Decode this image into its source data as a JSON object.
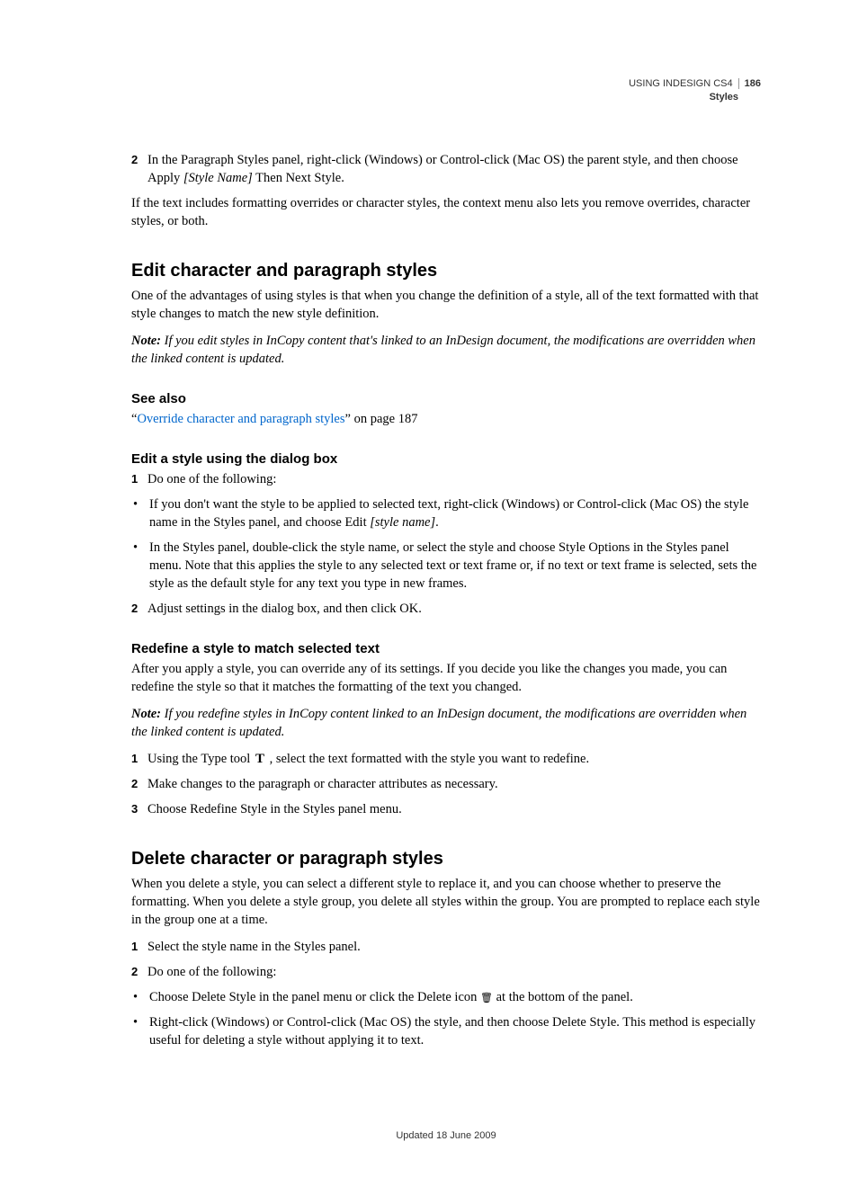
{
  "header": {
    "product": "USING INDESIGN CS4",
    "section": "Styles",
    "page": "186"
  },
  "top": {
    "step2_a": "In the Paragraph Styles panel, right-click (Windows) or Control-click (Mac OS) the parent style, and then choose Apply ",
    "step2_i": "[Style Name]",
    "step2_b": " Then Next Style.",
    "para": "If the text includes formatting overrides or character styles, the context menu also lets you remove overrides, character styles, or both."
  },
  "sec1": {
    "title": "Edit character and paragraph styles",
    "p1": "One of the advantages of using styles is that when you change the definition of a style, all of the text formatted with that style changes to match the new style definition.",
    "note_label": "Note: ",
    "note_text": "If you edit styles in InCopy content that's linked to an InDesign document, the modifications are overridden when the linked content is updated.",
    "seealso": "See also",
    "seealso_q1": "“",
    "seealso_link": "Override character and paragraph styles",
    "seealso_tail": "” on page 187",
    "sub1": "Edit a style using the dialog box",
    "s1_1": "Do one of the following:",
    "s1_b1a": "If you don't want the style to be applied to selected text, right-click (Windows) or Control-click (Mac OS) the style name in the Styles panel, and choose Edit ",
    "s1_b1i": "[style name]",
    "s1_b1b": ".",
    "s1_b2": "In the Styles panel, double-click the style name, or select the style and choose Style Options in the Styles panel menu. Note that this applies the style to any selected text or text frame or, if no text or text frame is selected, sets the style as the default style for any text you type in new frames.",
    "s1_2": "Adjust settings in the dialog box, and then click OK.",
    "sub2": "Redefine a style to match selected text",
    "s2_p1": "After you apply a style, you can override any of its settings. If you decide you like the changes you made, you can redefine the style so that it matches the formatting of the text you changed.",
    "s2_note_label": "Note: ",
    "s2_note_text": "If you redefine styles in InCopy content linked to an InDesign document, the modifications are overridden when the linked content is updated.",
    "s2_1a": "Using the Type tool ",
    "s2_1b": " , select the text formatted with the style you want to redefine.",
    "s2_2": "Make changes to the paragraph or character attributes as necessary.",
    "s2_3": "Choose Redefine Style in the Styles panel menu."
  },
  "sec2": {
    "title": "Delete character or paragraph styles",
    "p1": "When you delete a style, you can select a different style to replace it, and you can choose whether to preserve the formatting. When you delete a style group, you delete all styles within the group. You are prompted to replace each style in the group one at a time.",
    "s1": "Select the style name in the Styles panel.",
    "s2": "Do one of the following:",
    "b1a": "Choose Delete Style in the panel menu or click the Delete icon ",
    "b1b": " at the bottom of the panel.",
    "b2": "Right-click (Windows) or Control-click (Mac OS) the style, and then choose Delete Style. This method is especially useful for deleting a style without applying it to text."
  },
  "footer": "Updated 18 June 2009"
}
